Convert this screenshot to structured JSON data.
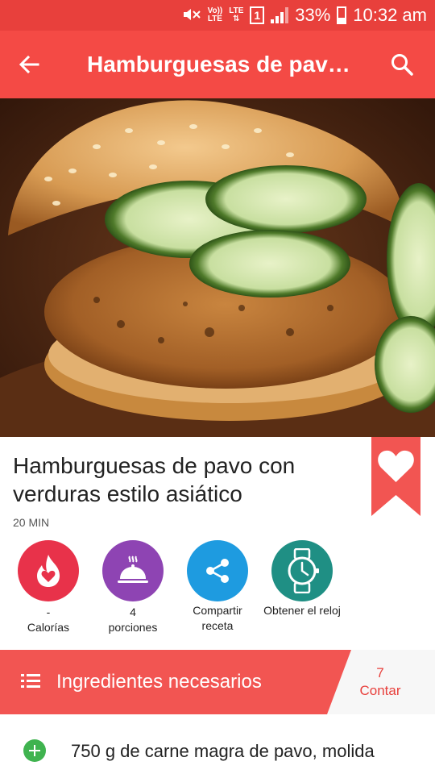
{
  "status_bar": {
    "volte_top": "Vo))",
    "volte_bottom": "LTE",
    "lte_top": "LTE",
    "lte_arrows": "⇅",
    "sim_slot": "1",
    "battery_percent": "33%",
    "time": "10:32 am"
  },
  "app_bar": {
    "title": "Hamburguesas de pav…",
    "back_icon": "arrow-back-icon",
    "search_icon": "search-icon"
  },
  "hero_image": {
    "subject": "turkey-burger-with-cucumber-photo"
  },
  "recipe": {
    "title": "Hamburguesas de pavo con verduras estilo asiático",
    "time": "20 MIN"
  },
  "actions": [
    {
      "value": "-",
      "label": "Calorías",
      "icon": "flame-heart-icon",
      "color": "#e8324a"
    },
    {
      "value": "4",
      "label": "porciones",
      "icon": "serving-dish-icon",
      "color": "#8e44b3"
    },
    {
      "value": "",
      "label": "Compartir receta",
      "icon": "share-icon",
      "color": "#1e9be0"
    },
    {
      "value": "",
      "label": "Obtener el reloj",
      "icon": "watch-icon",
      "color": "#1f8f84"
    }
  ],
  "ingredients": {
    "header": "Ingredientes necesarios",
    "count": "7",
    "count_label": "Contar",
    "items": [
      {
        "text": "750 g de carne magra de pavo, molida"
      }
    ]
  },
  "colors": {
    "status_bar": "#e8403c",
    "app_bar": "#f44a45",
    "accent": "#f25552",
    "add_button": "#3fb34f"
  }
}
